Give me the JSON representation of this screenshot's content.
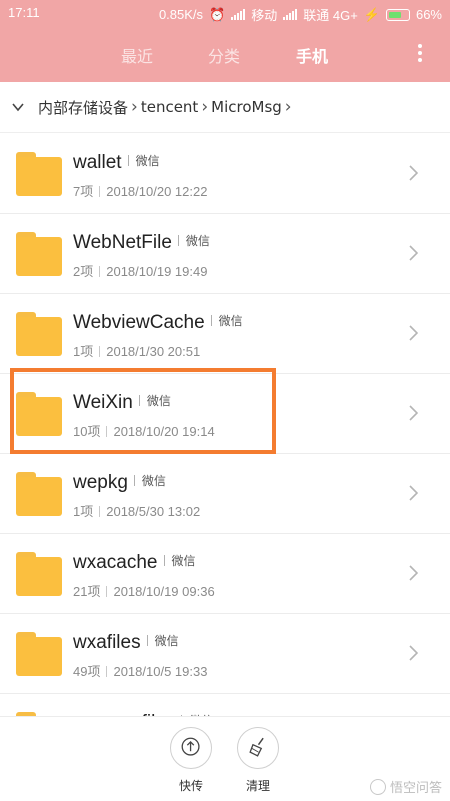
{
  "status_bar": {
    "time": "17:11",
    "speed": "0.85K/s",
    "carrier1": "移动",
    "carrier2": "联通 4G+",
    "battery": "66%"
  },
  "tabs": [
    {
      "label": "最近",
      "active": false
    },
    {
      "label": "分类",
      "active": false
    },
    {
      "label": "手机",
      "active": true
    }
  ],
  "breadcrumb": [
    "内部存储设备",
    "tencent",
    "MicroMsg"
  ],
  "rows": [
    {
      "name": "wallet",
      "tag": "微信",
      "count": "7项",
      "date": "2018/10/20 12:22"
    },
    {
      "name": "WebNetFile",
      "tag": "微信",
      "count": "2项",
      "date": "2018/10/19 19:49"
    },
    {
      "name": "WebviewCache",
      "tag": "微信",
      "count": "1项",
      "date": "2018/1/30 20:51"
    },
    {
      "name": "WeiXin",
      "tag": "微信",
      "count": "10项",
      "date": "2018/10/20 19:14"
    },
    {
      "name": "wepkg",
      "tag": "微信",
      "count": "1项",
      "date": "2018/5/30 13:02"
    },
    {
      "name": "wxacache",
      "tag": "微信",
      "count": "21项",
      "date": "2018/10/19 09:36"
    },
    {
      "name": "wxafiles",
      "tag": "微信",
      "count": "49项",
      "date": "2018/10/5 19:33"
    },
    {
      "name": "wxanewfiles",
      "tag": "微信",
      "count": "",
      "date": ""
    }
  ],
  "bottom_actions": [
    {
      "label": "快传",
      "icon": "share-arrow-icon"
    },
    {
      "label": "清理",
      "icon": "broom-icon"
    }
  ],
  "watermark": "悟空问答",
  "colors": {
    "header": "#f1a6a6",
    "folder": "#fbbf3f",
    "highlight": "#f47c30"
  }
}
